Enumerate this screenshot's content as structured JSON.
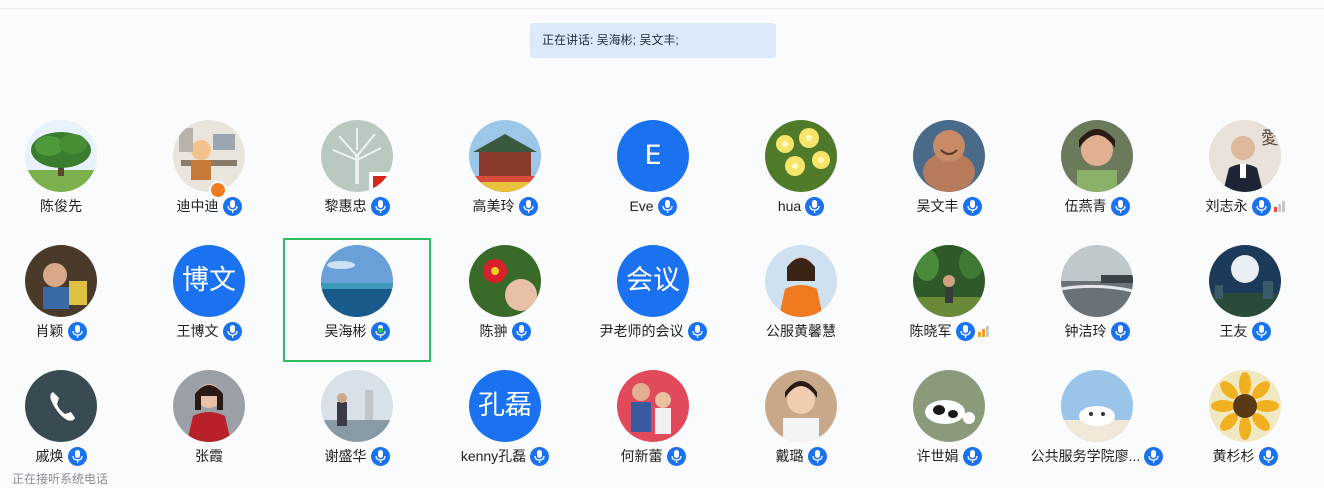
{
  "speaking_banner": "正在讲话: 吴海彬; 吴文丰;",
  "status_bar": "正在接听系统电话",
  "colors": {
    "accent": "#1a72f0",
    "active_border": "#2dbd63",
    "banner_bg": "#dce9fb"
  },
  "participants": [
    {
      "name": "陈俊先",
      "mic": false,
      "avatar": "tree-photo"
    },
    {
      "name": "迪中迪",
      "mic": true,
      "avatar": "cartoon-desk-photo",
      "host_badge": true
    },
    {
      "name": "黎惠忠",
      "mic": true,
      "avatar": "tree-art-photo",
      "flag_badge": true
    },
    {
      "name": "高美玲",
      "mic": true,
      "avatar": "temple-photo"
    },
    {
      "name": " Eve",
      "mic": true,
      "avatar_text": "E"
    },
    {
      "name": "hua",
      "mic": true,
      "avatar": "flowers-photo"
    },
    {
      "name": "吴文丰",
      "mic": true,
      "avatar": "buddha-photo"
    },
    {
      "name": "伍燕青",
      "mic": true,
      "avatar": "woman-photo"
    },
    {
      "name": "刘志永",
      "mic": true,
      "avatar": "man-suit-photo",
      "signal": "weak-red"
    },
    {
      "name": "肖颖",
      "mic": true,
      "avatar": "child-photo"
    },
    {
      "name": "王博文",
      "mic": true,
      "avatar_text": "博文"
    },
    {
      "name": "吴海彬",
      "mic": true,
      "avatar": "sea-photo",
      "active": true,
      "speaking": true
    },
    {
      "name": "陈翀",
      "mic": true,
      "avatar": "flower-child-photo"
    },
    {
      "name": "尹老师的会议",
      "mic": true,
      "avatar_text": "会议"
    },
    {
      "name": "公服黄馨慧",
      "mic": false,
      "avatar": "woman-orange-photo"
    },
    {
      "name": "陈晓军",
      "mic": true,
      "avatar": "garden-photo",
      "signal": "medium-orange"
    },
    {
      "name": "钟洁玲",
      "mic": true,
      "avatar": "beach-photo"
    },
    {
      "name": "王友",
      "mic": true,
      "avatar": "moon-city-photo"
    },
    {
      "name": "戚焕",
      "mic": true,
      "avatar": "phone-icon-avatar"
    },
    {
      "name": "张霞",
      "mic": false,
      "avatar": "woman-red-photo"
    },
    {
      "name": "谢盛华",
      "mic": true,
      "avatar": "statue-photo"
    },
    {
      "name": "kenny孔磊",
      "mic": true,
      "avatar_text": "孔磊"
    },
    {
      "name": "何新蕾",
      "mic": true,
      "avatar": "family-photo"
    },
    {
      "name": "戴璐",
      "mic": true,
      "avatar": "girl-photo"
    },
    {
      "name": "许世娟",
      "mic": true,
      "avatar": "cartoon-cow"
    },
    {
      "name": "公共服务学院廖...",
      "mic": true,
      "avatar": "cartoon-sky"
    },
    {
      "name": "黄杉杉",
      "mic": true,
      "avatar": "sunflower-photo"
    }
  ]
}
